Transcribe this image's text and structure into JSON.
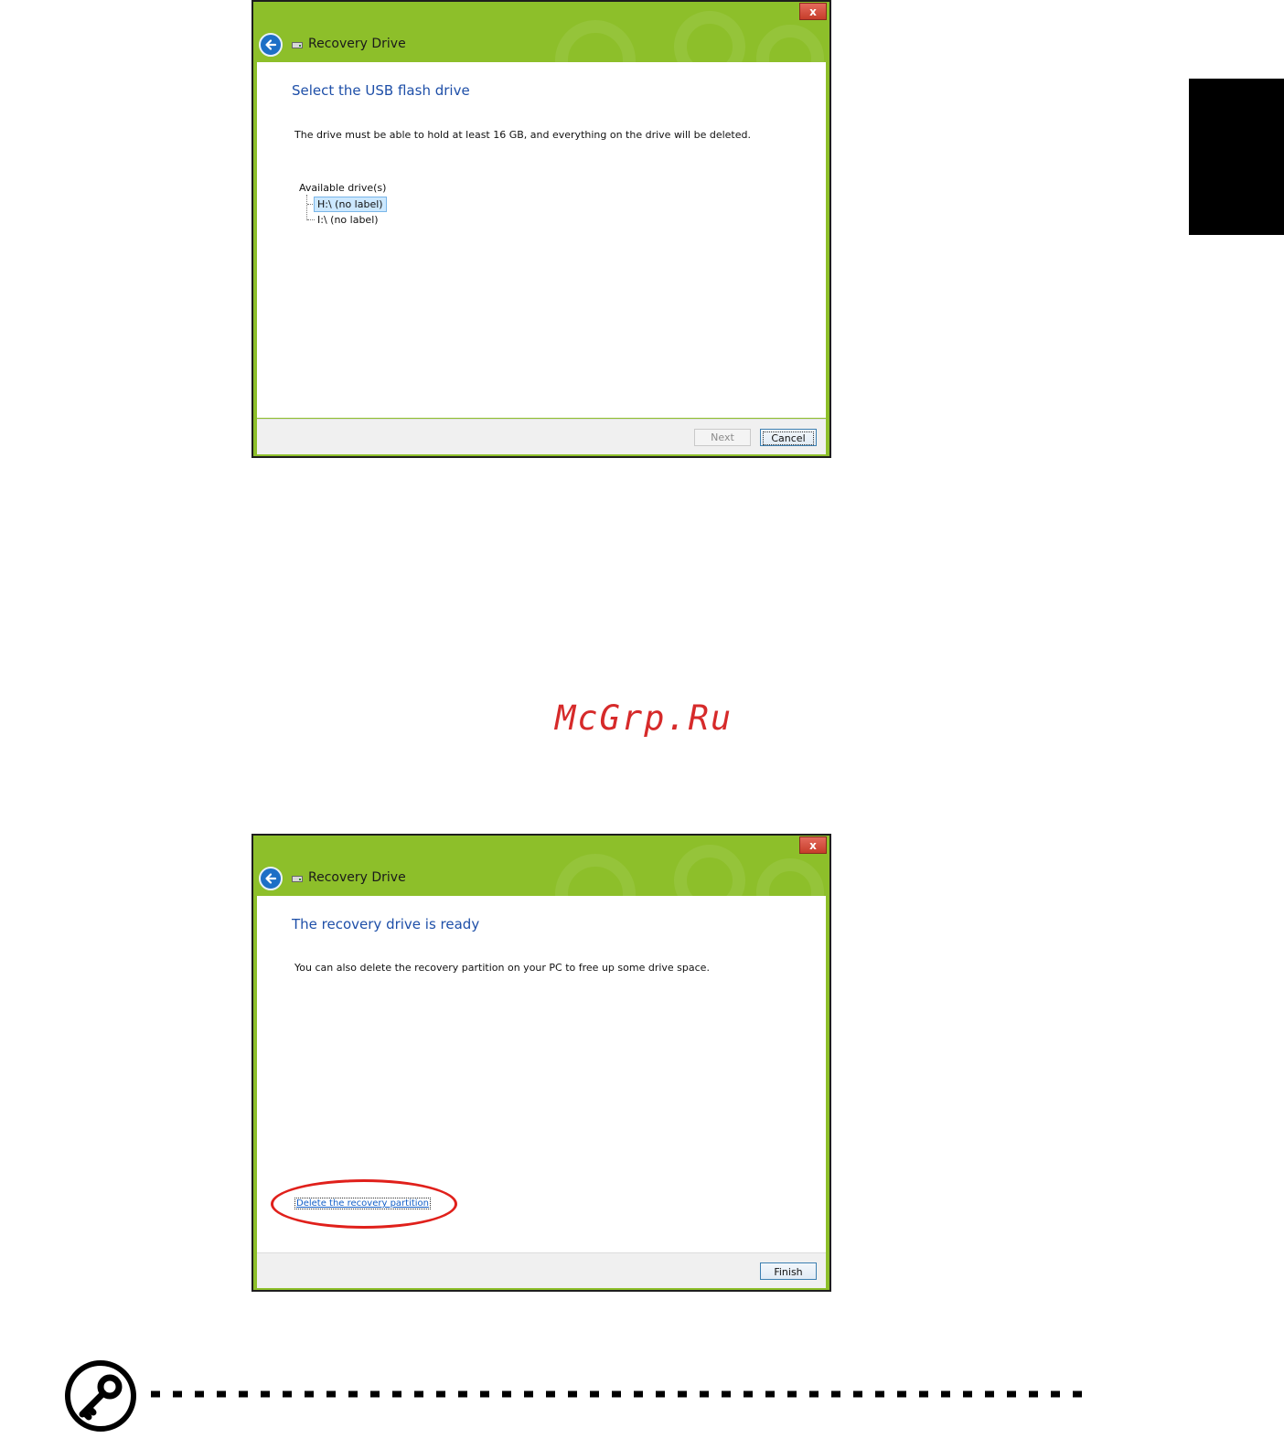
{
  "dialog1": {
    "title": "Recovery Drive",
    "close_label": "x",
    "heading": "Select the USB flash drive",
    "description": "The drive must be able to hold at least 16 GB, and everything on the drive will be deleted.",
    "drives_label": "Available drive(s)",
    "drives": [
      {
        "label": "H:\\ (no label)",
        "selected": true
      },
      {
        "label": "I:\\ (no label)",
        "selected": false
      }
    ],
    "next_label": "Next",
    "cancel_label": "Cancel"
  },
  "dialog2": {
    "title": "Recovery Drive",
    "close_label": "x",
    "heading": "The recovery drive is ready",
    "description": "You can also delete the recovery partition on your PC to free up some drive space.",
    "delete_link": "Delete the recovery partition",
    "finish_label": "Finish"
  },
  "watermark": "McGrp.Ru",
  "colors": {
    "titlebar_green": "#8dbf2a",
    "heading_blue": "#1e4fa8",
    "highlight_red": "#e0201b"
  }
}
